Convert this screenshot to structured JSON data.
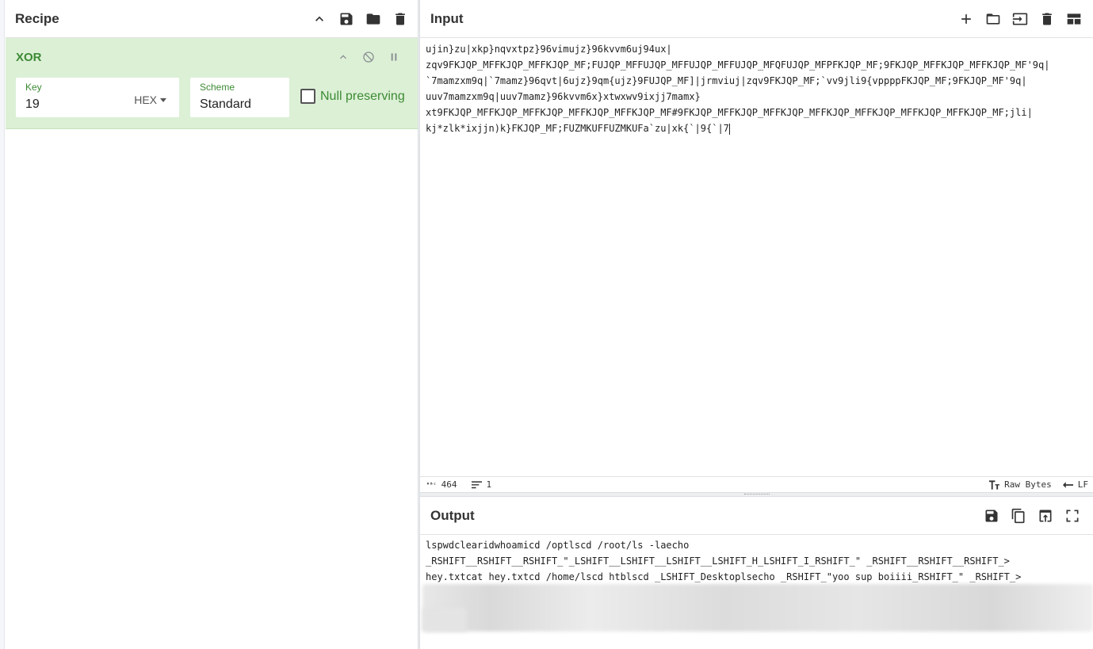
{
  "recipe": {
    "title": "Recipe",
    "operation": {
      "name": "XOR",
      "key": {
        "label": "Key",
        "value": "19",
        "format": "HEX"
      },
      "scheme": {
        "label": "Scheme",
        "value": "Standard"
      },
      "null_preserving": {
        "label": "Null preserving",
        "checked": false
      }
    }
  },
  "input": {
    "title": "Input",
    "lines": [
      "ujin}zu|xkp}nqvxtpz}96vimujz}96kvvm6uj94ux|",
      "zqv9FKJQP_MFFKJQP_MFFKJQP_MF;FUJQP_MFFUJQP_MFFUJQP_MFFUJQP_MFQFUJQP_MFPFKJQP_MF;9FKJQP_MFFKJQP_MFFKJQP_MF'9q|",
      "`7mamzxm9q|`7mamz}96qvt|6ujz}9qm{ujz}9FUJQP_MF]|jrmviuj|zqv9FKJQP_MF;`vv9jli9{vppppFKJQP_MF;9FKJQP_MF'9q|",
      "uuv7mamzxm9q|uuv7mamz}96kvvm6x}xtwxwv9ixjj7mamx}",
      "xt9FKJQP_MFFKJQP_MFFKJQP_MFFKJQP_MFFKJQP_MF#9FKJQP_MFFKJQP_MFFKJQP_MFFKJQP_MFFKJQP_MFFKJQP_MFFKJQP_MF;jli|",
      "kj*zlk*ixjjn)k}FKJQP_MF;FUZMKUFFUZMKUFa`zu|xk{`|9{`|7"
    ],
    "status": {
      "char_label": "ᴿᴮᶜ",
      "char_count": "464",
      "line_count": "1",
      "encoding": "Raw Bytes",
      "eol": "LF"
    }
  },
  "output": {
    "title": "Output",
    "lines": [
      "lspwdclearidwhoamicd /optlscd /root/ls -laecho",
      "_RSHIFT__RSHIFT__RSHIFT_\"_LSHIFT__LSHIFT__LSHIFT__LSHIFT_H_LSHIFT_I_RSHIFT_\" _RSHIFT__RSHIFT__RSHIFT_>",
      "hey.txtcat hey.txtcd /home/lscd htblscd _LSHIFT_Desktoplsecho _RSHIFT_\"yoo sup boiiii_RSHIFT_\" _RSHIFT_>"
    ]
  },
  "colors": {
    "op_bg": "#dcf0d6",
    "op_accent": "#3d8a34"
  }
}
